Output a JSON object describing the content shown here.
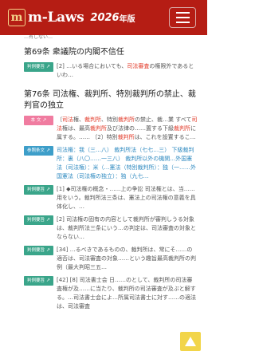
{
  "header": {
    "logo_mark": "m",
    "logo_text": "m-Laws",
    "year": "2026",
    "year_suffix": "年版"
  },
  "cut_line": "…有しない…",
  "art69": {
    "title": "第69条 衆議院の内閣不信任",
    "badge": "判例要旨",
    "text_a": "[2] …いる場合においても、",
    "text_red": "司法審査",
    "text_b": "の権限外であるといわ…"
  },
  "art76": {
    "title": "第76条 司法権、裁判所、特別裁判所の禁止、裁判官の独立",
    "body_badge": "本 文",
    "body_1": "〔",
    "body_red1": "司法",
    "body_2": "権、",
    "body_red2": "裁判所",
    "body_3": "、特別",
    "body_red3": "裁判所",
    "body_4": "の禁止、裁…業 すべて",
    "body_red4": "司法",
    "body_5": "権は、最高",
    "body_red5": "裁判所",
    "body_6": "及び法律の……置する下級",
    "body_red6": "裁判所",
    "body_7": "に属する。…… 〔2〕特別",
    "body_red7": "裁判所",
    "body_8": "は、これを設置するこ…",
    "ref_badge": "参照条文",
    "ref_text": "司法権：我（三…八） 裁判所法（七七…三） 下級裁判所：裏（八〇……一三八） 裁判所以外の機関…外国憲法（司法権）：米（…憲法（特別裁判所）：独（一……外国憲法（司法権の独立）：独（九七…",
    "p1_badge": "判例要旨",
    "p1_text": "[1] ◆司法権の概念・……上の争訟 司法権とは、当……用をいう。裁判所法三条は、憲法上の司法権の意義を具体化し、…",
    "p2_badge": "判例要旨",
    "p2_text": "[2] 司法権の固有の内容として裁判所が審判しうる対象は、裁判所法三条にいう…の判定は、司法審査の対象とならない…",
    "p3_badge": "判例要旨",
    "p3_text": "[34] …るべきであるものの、裁判所は、常にそ……の適否は、司法審査の対象……という趣旨最高裁判所の判例（最大判昭三五…",
    "p4_badge": "判例要旨",
    "p4_text": "[42] [8] 司法書士会 日……のとして、裁判所の司法審査権が及……に当たり、裁判所の司法審査が及ぶと解する。…司法書士会によ…所属司法書士に対す……の適法は、司法審査"
  },
  "colors": {
    "header_bg": "#b51d14",
    "accent_red": "#e23b2a",
    "badge_green": "#3aa58a",
    "badge_pink": "#f07ca0",
    "badge_blue": "#3d9ec9",
    "scroll_top_btn": "#f2d54a"
  },
  "icons": {
    "menu": "hamburger-icon",
    "external": "external-link-icon",
    "scroll_top": "triangle-up-icon"
  }
}
